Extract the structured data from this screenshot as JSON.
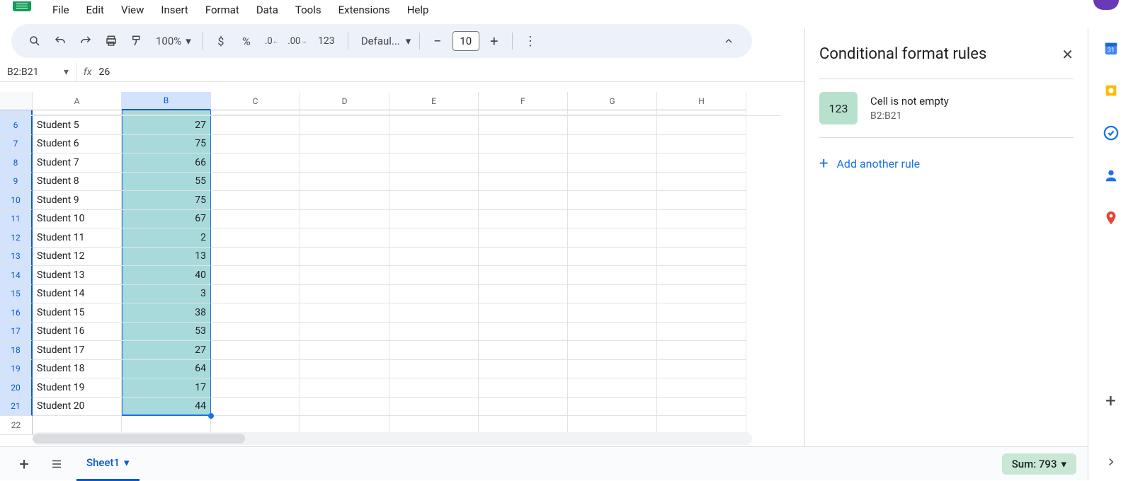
{
  "menubar": [
    "File",
    "Edit",
    "View",
    "Insert",
    "Format",
    "Data",
    "Tools",
    "Extensions",
    "Help"
  ],
  "toolbar": {
    "zoom": "100%",
    "currency": "$",
    "percent": "%",
    "num_format": "123",
    "font_name": "Defaul...",
    "font_size": "10"
  },
  "name_box": "B2:B21",
  "fx_label": "fx",
  "formula_value": "26",
  "columns": [
    "A",
    "B",
    "C",
    "D",
    "E",
    "F",
    "G",
    "H"
  ],
  "rows": [
    {
      "n": "",
      "a": "",
      "b": ""
    },
    {
      "n": "6",
      "a": "Student 5",
      "b": "27"
    },
    {
      "n": "7",
      "a": "Student 6",
      "b": "75"
    },
    {
      "n": "8",
      "a": "Student 7",
      "b": "66"
    },
    {
      "n": "9",
      "a": "Student 8",
      "b": "55"
    },
    {
      "n": "10",
      "a": "Student 9",
      "b": "75"
    },
    {
      "n": "11",
      "a": "Student 10",
      "b": "67"
    },
    {
      "n": "12",
      "a": "Student 11",
      "b": "2"
    },
    {
      "n": "13",
      "a": "Student 12",
      "b": "13"
    },
    {
      "n": "14",
      "a": "Student 13",
      "b": "40"
    },
    {
      "n": "15",
      "a": "Student 14",
      "b": "3"
    },
    {
      "n": "16",
      "a": "Student 15",
      "b": "38"
    },
    {
      "n": "17",
      "a": "Student 16",
      "b": "53"
    },
    {
      "n": "18",
      "a": "Student 17",
      "b": "27"
    },
    {
      "n": "19",
      "a": "Student 18",
      "b": "64"
    },
    {
      "n": "20",
      "a": "Student 19",
      "b": "17"
    },
    {
      "n": "21",
      "a": "Student 20",
      "b": "44"
    },
    {
      "n": "22",
      "a": "",
      "b": ""
    }
  ],
  "side_panel": {
    "title": "Conditional format rules",
    "rule_preview": "123",
    "rule_condition": "Cell is not empty",
    "rule_range": "B2:B21",
    "add_rule": "Add another rule"
  },
  "bottom": {
    "sheet_name": "Sheet1",
    "summary": "Sum: 793"
  }
}
